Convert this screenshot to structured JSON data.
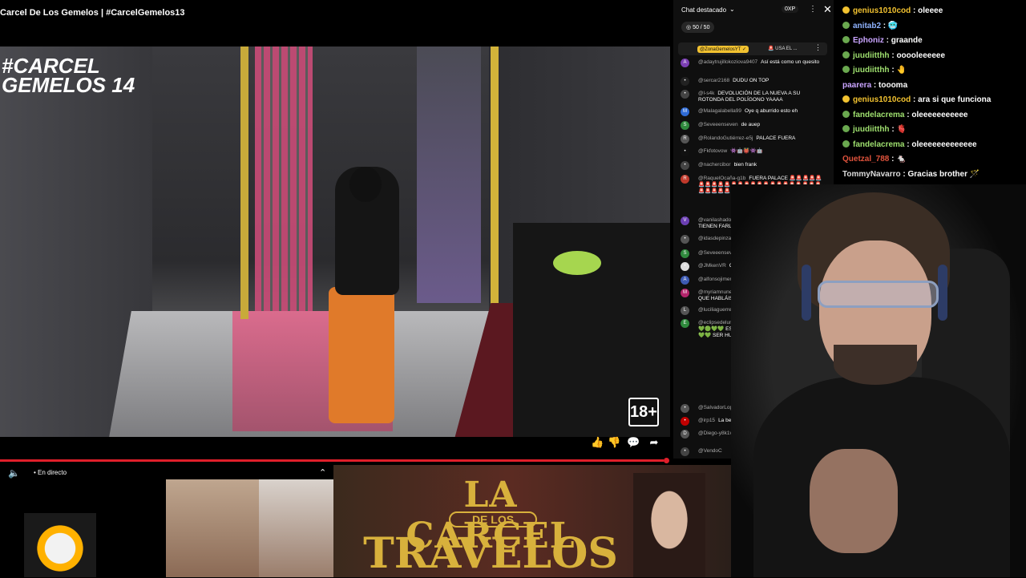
{
  "video": {
    "title": "Carcel De Los Gemelos | #CarcelGemelos13",
    "watermark_line1": "#CARCEL",
    "watermark_line2": "GEMELOS 14",
    "badge": "18+",
    "live_label": "• En directo",
    "progress_percent": 99
  },
  "banner": {
    "line1": "LA CARCEL",
    "line2": "DE LOS",
    "line3": "TRAVELOS"
  },
  "chat": {
    "header": "Chat destacado",
    "xp": "0XP",
    "counter": "50 / 50",
    "pinned_author": "@ZonaGemelosYT ✓",
    "pinned_text": "🚨 USA EL ...",
    "messages": [
      {
        "initial": "A",
        "color": "#7b3fb3",
        "author": "@adaytrujillokoziova9407",
        "text": "Así está como un quesito"
      },
      {
        "initial": "•",
        "color": "#222222",
        "author": "@sercar2168",
        "text": "DUDU ON TOP"
      },
      {
        "initial": "•",
        "color": "#444444",
        "author": "@l-s4k",
        "text": "DEVOLUCIÓN DE LA NUEVA A SU ROTONDA DEL POLÍGONO YAAAA"
      },
      {
        "initial": "M",
        "color": "#2e6bd6",
        "author": "@Malagalabella99",
        "text": "Oye q aburrido esto eh"
      },
      {
        "initial": "S",
        "color": "#2f8a3d",
        "author": "@Seveeenseven",
        "text": "de auep"
      },
      {
        "initial": "R",
        "color": "#555555",
        "author": "@RolandoGutiérrez-e5j",
        "text": "PALACE FUERA"
      },
      {
        "initial": "•",
        "color": "#111111",
        "author": "@Fkfotovow",
        "text": "👾🤖👹👾🤖"
      },
      {
        "initial": "•",
        "color": "#444444",
        "author": "@nachercibor",
        "text": "bien frank"
      },
      {
        "initial": "R",
        "color": "#c0392b",
        "author": "@RaquelOcaña-g1b",
        "text": "FUERA PALACE 🚨🚨🚨🚨🚨🚨🚨🚨🚨🚨🚨🚨🚨🚨🚨🚨🚨🚨🚨🚨🚨🚨🚨🚨🚨🚨🚨🚨🚨🚨"
      },
      {
        "initial": "V",
        "color": "#6b3fb3",
        "author": "@vanilashadow7860",
        "text": "MORRITOS Y LA NUEVA TIENEN FARLOPA"
      },
      {
        "initial": "•",
        "color": "#555555",
        "author": "@idasdepinza",
        "text": "ESTÁN DE LÍO"
      },
      {
        "initial": "S",
        "color": "#2f8a3d",
        "author": "@Seveeenseven",
        "text": "No"
      },
      {
        "initial": "•",
        "color": "#dddddd",
        "author": "@JMkenVR",
        "text": "QUE HA PASADO EN EL ASEO?"
      },
      {
        "initial": "A",
        "color": "#3d5ab3",
        "author": "@alfonsojimenez8934",
        "text": "Y falete"
      },
      {
        "initial": "M",
        "color": "#b3246b",
        "author": "@myriamnunez9229",
        "text": "FALETE TIRO LAS PLANCHAS QUE HABLÁIS SIN SABER!!!!"
      },
      {
        "initial": "L",
        "color": "#555555",
        "author": "@luciliaguerrero",
        "text": "FUERA PALACEEE"
      },
      {
        "initial": "E",
        "color": "#2f8a3d",
        "author": "@eclipsedeluna6580",
        "text": "💚🟢💚💚🟢💚 ESTAMOS 💚💚🟢💚💚 ES PRIMERO 💚🟢 HAY QUE DESCA 🟢💚💚 SER HUMANO EN 😡😡😡"
      },
      {
        "initial": "•",
        "color": "#555555",
        "author": "@SalvadorLopez-s",
        "text": ""
      },
      {
        "initial": "•",
        "color": "#c00000",
        "author": "@irp15",
        "text": "La bea e"
      },
      {
        "initial": "D",
        "color": "#555555",
        "author": "@Diego-y8k1v",
        "text": "PERR"
      },
      {
        "initial": "•",
        "color": "#444444",
        "author": "@VendoC",
        "text": ""
      }
    ]
  },
  "twitch_chat": [
    {
      "user": "genius1010cod",
      "color": "#f2c230",
      "badge": "#f2c230",
      "msg": "oleeee"
    },
    {
      "user": "anitab2",
      "color": "#8fb3ff",
      "badge": "#6aa84f",
      "msg": "🥶"
    },
    {
      "user": "Ephoniz",
      "color": "#c9a4ff",
      "badge": "#6aa84f",
      "msg": "graande"
    },
    {
      "user": "juudiitthh",
      "color": "#9fe06f",
      "badge": "#6aa84f",
      "msg": "ooooleeeeee"
    },
    {
      "user": "juudiitthh",
      "color": "#9fe06f",
      "badge": "#6aa84f",
      "msg": "🤚"
    },
    {
      "user": "paarera",
      "color": "#c9a4ff",
      "badge": "",
      "msg": "toooma"
    },
    {
      "user": "genius1010cod",
      "color": "#f2c230",
      "badge": "#f2c230",
      "msg": "ara si que funciona"
    },
    {
      "user": "fandelacrema",
      "color": "#9fe06f",
      "badge": "#6aa84f",
      "msg": "oleeeeeeeeeee"
    },
    {
      "user": "juudiitthh",
      "color": "#9fe06f",
      "badge": "#6aa84f",
      "msg": "🫀"
    },
    {
      "user": "fandelacrema",
      "color": "#9fe06f",
      "badge": "#6aa84f",
      "msg": "oleeeeeeeeeeeee"
    },
    {
      "user": "Quetzal_788",
      "color": "#e0533c",
      "badge": "",
      "msg": "🐁"
    },
    {
      "user": "TommyNavarro",
      "color": "#dddddd",
      "badge": "",
      "msg": "Gracias brother 🪄"
    }
  ]
}
